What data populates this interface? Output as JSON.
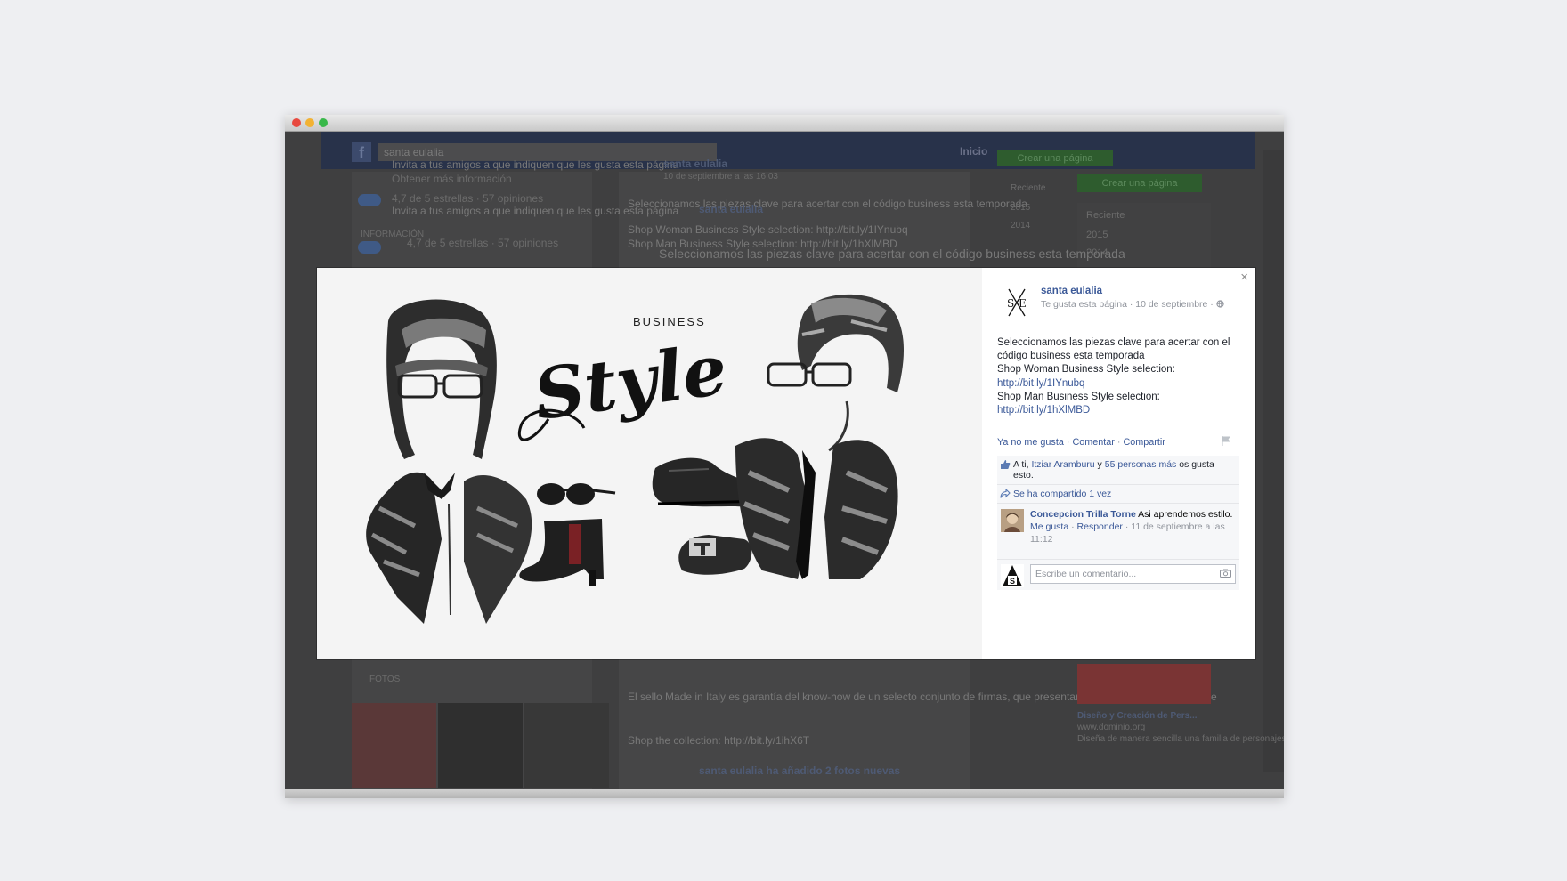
{
  "window": {
    "traffic_lights": [
      "close",
      "minimize",
      "zoom"
    ]
  },
  "background": {
    "search_value": "santa eulalia",
    "nav_home": "Inicio",
    "create_page": "Crear una página",
    "left_col": [
      "Invita a tus amigos a que indiquen que les gusta esta página",
      "Obtener más información",
      "4,7 de 5 estrellas · 57 opiniones",
      "INFORMACIÓN",
      "FOTOS"
    ],
    "mid_col": [
      "santa eulalia",
      "10 de septiembre a las 16:03",
      "Seleccionamos las piezas clave para acertar con el código business esta temporada",
      "Shop Woman Business Style selection: http://bit.ly/1IYnubq",
      "Shop Man Business Style selection: http://bit.ly/1hXlMBD",
      "El sello Made in Italy es garantía del know-how de un selecto conjunto de firmas, que presentamos en el nuevo pop-up store",
      "Shop the collection: http://bit.ly/1ihX6T",
      "santa eulalia ha añadido 2 fotos nuevas"
    ],
    "right_col": [
      "Reciente",
      "2015",
      "2014",
      "Diseño y Creación de Pers...",
      "www.dominio.org",
      "Diseña de manera sencilla una familia de personajes"
    ]
  },
  "photo": {
    "heading_small": "BUSINESS",
    "heading_script": "Style"
  },
  "post": {
    "page_name": "santa eulalia",
    "meta": "Te gusta esta página · 10 de septiembre · ",
    "lines": [
      "Seleccionamos las piezas clave para acertar con el código business esta temporada",
      "Shop Woman Business Style selection:"
    ],
    "link_woman": "http://bit.ly/1IYnubq",
    "line_man": "Shop Man Business Style selection:",
    "link_man": "http://bit.ly/1hXlMBD",
    "actions": {
      "unlike": "Ya no me gusta",
      "comment": "Comentar",
      "share": "Compartir",
      "sep": " · "
    },
    "likes": {
      "prefix": "A ti, ",
      "friend": "Itziar Aramburu",
      "mid": " y ",
      "others": "55 personas más",
      "suffix": " os gusta esto."
    },
    "shares": "Se ha compartido 1 vez",
    "comment": {
      "author": "Concepcion Trilla Torne",
      "text": " Asi aprendemos estilo.",
      "like": "Me gusta",
      "reply": "Responder",
      "time": "11 de septiembre a las 11:12",
      "sep": " · "
    },
    "write_placeholder": "Escribe un comentario...",
    "close": "×"
  },
  "colors": {
    "link": "#3b5998",
    "overlay": "#3f3f40"
  }
}
